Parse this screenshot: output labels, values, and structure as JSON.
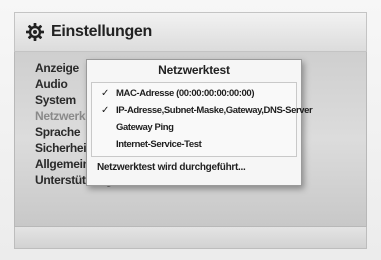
{
  "header": {
    "title": "Einstellungen",
    "icon": "gear-icon"
  },
  "menu": {
    "items": [
      {
        "label": "Anzeige",
        "dim": false
      },
      {
        "label": "Audio",
        "dim": false
      },
      {
        "label": "System",
        "dim": false
      },
      {
        "label": "Netzwerk",
        "dim": true
      },
      {
        "label": "Sprache",
        "dim": false
      },
      {
        "label": "Sicherheit",
        "dim": false
      },
      {
        "label": "Allgemein",
        "dim": false
      },
      {
        "label": "Unterstützung",
        "dim": false
      }
    ]
  },
  "dialog": {
    "title": "Netzwerktest",
    "tests": [
      {
        "label": "MAC-Adresse (00:00:00:00:00:00)",
        "checked": true
      },
      {
        "label": "IP-Adresse,Subnet-Maske,Gateway,DNS-Server",
        "checked": true
      },
      {
        "label": "Gateway Ping",
        "checked": false
      },
      {
        "label": "Internet-Service-Test",
        "checked": false
      }
    ],
    "check_glyph": "✓",
    "status": "Netzwerktest wird durchgeführt..."
  }
}
